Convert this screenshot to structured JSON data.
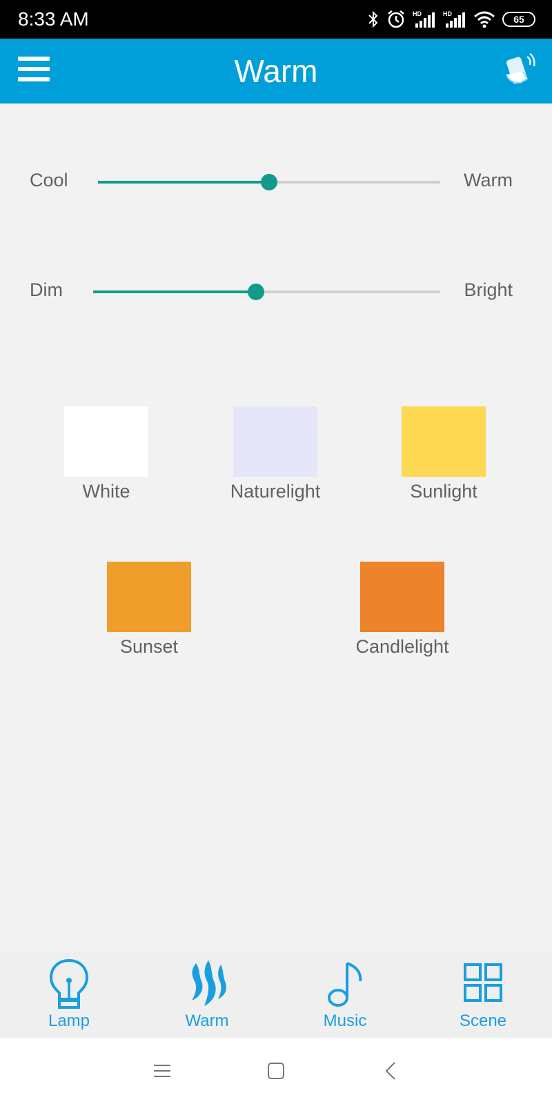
{
  "status_bar": {
    "time": "8:33 AM",
    "battery": "65",
    "icons": [
      "bluetooth-icon",
      "alarm-icon",
      "hd-signal-icon",
      "hd-signal-icon",
      "wifi-icon",
      "battery-icon"
    ]
  },
  "app_bar": {
    "title": "Warm",
    "menu_icon": "hamburger-menu-icon",
    "action_icon": "shake-phone-icon"
  },
  "sliders": {
    "color_temp": {
      "left_label": "Cool",
      "right_label": "Warm",
      "value": 0.5
    },
    "brightness": {
      "left_label": "Dim",
      "right_label": "Bright",
      "value": 0.47
    }
  },
  "presets": [
    {
      "label": "White",
      "color": "#ffffff"
    },
    {
      "label": "Naturelight",
      "color": "#e6e6f9"
    },
    {
      "label": "Sunlight",
      "color": "#fdd954"
    },
    {
      "label": "Sunset",
      "color": "#f09e2b"
    },
    {
      "label": "Candlelight",
      "color": "#ed832a"
    }
  ],
  "bottom_nav": [
    {
      "label": "Lamp",
      "icon": "lightbulb-icon"
    },
    {
      "label": "Warm",
      "icon": "flame-icon",
      "active": true
    },
    {
      "label": "Music",
      "icon": "music-note-icon"
    },
    {
      "label": "Scene",
      "icon": "grid-icon"
    }
  ],
  "system_nav": [
    "recents-icon",
    "home-icon",
    "back-icon"
  ],
  "colors": {
    "accent": "#009fd9",
    "slider": "#129a8b",
    "nav_label": "#1a9ee0"
  }
}
